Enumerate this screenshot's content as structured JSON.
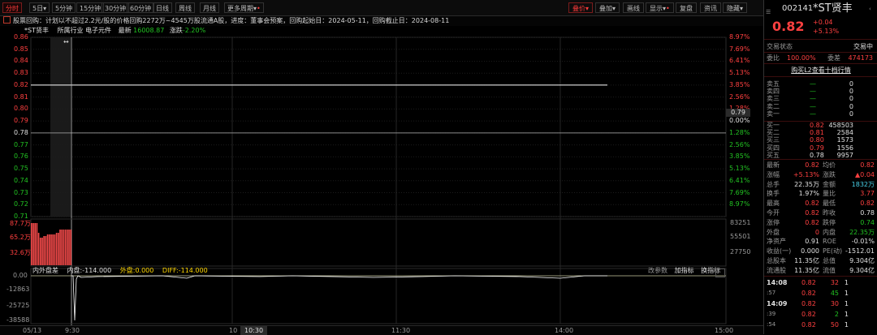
{
  "toolbar": {
    "tabs": [
      "分时",
      "5日",
      "5分钟",
      "15分钟",
      "30分钟",
      "60分钟",
      "日线",
      "周线",
      "月线",
      "更多周期"
    ],
    "right_tabs": [
      "叠价",
      "叠加",
      "画线",
      "显示",
      "复盘",
      "资讯",
      "隐藏"
    ],
    "dropdown_marker": "▾",
    "dot_marker": "•"
  },
  "info": {
    "text": "股票回购：计划以不超过2.2元/股的价格回购2272万~4545万股流通A股，进度：董事会预案，回购起始日：2024-05-11，回购截止日：2024-08-11",
    "stock_label": "*ST贤丰",
    "industry_label": "所属行业",
    "industry": "电子元件",
    "latest_label": "最新",
    "latest": "16008.87",
    "change_label": "涨跌",
    "change": "-2.20%"
  },
  "chart": {
    "price_levels": [
      "0.86",
      "0.85",
      "0.84",
      "0.83",
      "0.82",
      "0.81",
      "0.80",
      "0.79",
      "0.78",
      "0.77",
      "0.76",
      "0.75",
      "0.74",
      "0.73",
      "0.72",
      "0.71"
    ],
    "pct_levels": [
      "8.97%",
      "7.69%",
      "6.41%",
      "5.13%",
      "3.85%",
      "2.56%",
      "1.28%",
      "0.00%",
      "1.28%",
      "2.56%",
      "3.85%",
      "5.13%",
      "6.41%",
      "7.69%",
      "8.97%"
    ],
    "tag_value": "0.79",
    "volume_left": [
      "87.7万",
      "65.2万",
      "32.6万"
    ],
    "volume_right": [
      "83251",
      "55501",
      "27750"
    ],
    "diff_labels": [
      "内外盘差",
      "内盘:-114.000",
      "外盘:0.000",
      "DIFF:-114.000"
    ],
    "diff_buttons": [
      "改参数",
      "加指标",
      "换指标"
    ],
    "diff_scale": [
      "0.00",
      "-12863",
      "-25725",
      "-38588"
    ],
    "time_labels": [
      "05/13",
      "9:30",
      "10",
      "10:30",
      "11:30",
      "14:00",
      "15:00"
    ],
    "prev_close": 0.78,
    "line_price": 0.82
  },
  "quote": {
    "code": "002141",
    "name": "*ST贤丰",
    "price": "0.82",
    "change": "+0.04",
    "change_pct": "+5.13%",
    "status_label": "交易状态",
    "status": "交易中",
    "ratio_label": "委比",
    "ratio": "100.00%",
    "diff_label": "委差",
    "diff": "474173",
    "l2_link": "购买L2查看十档行情",
    "asks": [
      {
        "label": "卖五",
        "price": "—",
        "vol": "0"
      },
      {
        "label": "卖四",
        "price": "—",
        "vol": "0"
      },
      {
        "label": "卖三",
        "price": "—",
        "vol": "0"
      },
      {
        "label": "卖二",
        "price": "—",
        "vol": "0"
      },
      {
        "label": "卖一",
        "price": "—",
        "vol": "0"
      }
    ],
    "bids": [
      {
        "label": "买一",
        "price": "0.82",
        "vol": "458503"
      },
      {
        "label": "买二",
        "price": "0.81",
        "vol": "2584"
      },
      {
        "label": "买三",
        "price": "0.80",
        "vol": "1573"
      },
      {
        "label": "买四",
        "price": "0.79",
        "vol": "1556"
      },
      {
        "label": "买五",
        "price": "0.78",
        "vol": "9957"
      }
    ],
    "stats": [
      {
        "l1": "最新",
        "v1": "0.82",
        "l2": "均价",
        "v2": "0.82"
      },
      {
        "l1": "涨幅",
        "v1": "+5.13%",
        "l2": "涨跌",
        "v2": "▲0.04"
      },
      {
        "l1": "总手",
        "v1": "22.35万",
        "l2": "金额",
        "v2": "1832万"
      },
      {
        "l1": "换手",
        "v1": "1.97%",
        "l2": "量比",
        "v2": "3.77"
      },
      {
        "l1": "最高",
        "v1": "0.82",
        "l2": "最低",
        "v2": "0.82"
      },
      {
        "l1": "今开",
        "v1": "0.82",
        "l2": "昨收",
        "v2": "0.78"
      },
      {
        "l1": "涨停",
        "v1": "0.82",
        "l2": "跌停",
        "v2": "0.74"
      },
      {
        "l1": "外盘",
        "v1": "0",
        "l2": "内盘",
        "v2": "22.35万"
      },
      {
        "l1": "净资产",
        "v1": "0.91",
        "l2": "ROE",
        "v2": "-0.01%"
      },
      {
        "l1": "收益(一)",
        "v1": "0.000",
        "l2": "PE(动)",
        "v2": "-1512.01"
      },
      {
        "l1": "总股本",
        "v1": "11.35亿",
        "l2": "总值",
        "v2": "9.304亿"
      },
      {
        "l1": "流通股",
        "v1": "11.35亿",
        "l2": "流值",
        "v2": "9.304亿"
      }
    ],
    "ticks": [
      {
        "time": "14:08",
        "price": "0.82",
        "vol": "32",
        "n": "1"
      },
      {
        "time": ":57",
        "price": "0.82",
        "vol": "45",
        "n": "1"
      },
      {
        "time": "14:09",
        "price": "0.82",
        "vol": "30",
        "n": "1"
      },
      {
        "time": ":39",
        "price": "0.82",
        "vol": "2",
        "n": "1"
      },
      {
        "time": ":54",
        "price": "0.82",
        "vol": "50",
        "n": "1"
      }
    ]
  },
  "colors": {
    "up": "#ff4040",
    "down": "#22c322",
    "accent": "#ffd700"
  }
}
